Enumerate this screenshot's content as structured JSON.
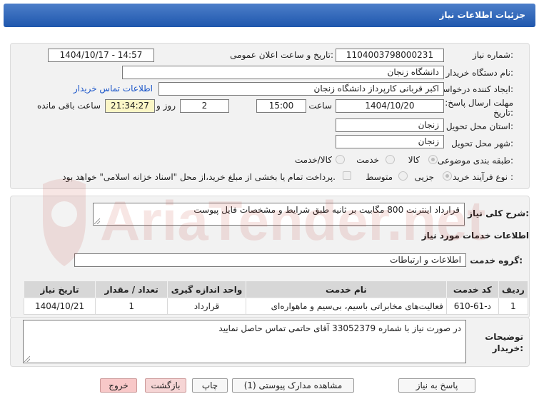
{
  "header": {
    "title": "جزئیات اطلاعات نیاز"
  },
  "details": {
    "need_number_label": "شماره نیاز:",
    "need_number": "1104003798000231",
    "announce_label": "تاریخ و ساعت اعلان عمومی:",
    "announce_value": "1404/10/17 - 14:57",
    "buyer_org_label": "نام دستگاه خریدار:",
    "buyer_org": "دانشگاه زنجان",
    "creator_label": "ایجاد کننده درخواست:",
    "creator": "اکبر قربانی کارپرداز دانشگاه زنجان",
    "contact_link": "اطلاعات تماس خریدار",
    "deadline_label_1": "مهلت ارسال پاسخ: تا",
    "deadline_label_2": "تاریخ:",
    "deadline_date": "1404/10/20",
    "time_label": "ساعت",
    "deadline_time": "15:00",
    "days_value": "2",
    "days_label": "روز و",
    "remaining_time": "21:34:27",
    "remaining_label": "ساعت باقی مانده",
    "province_label": "استان محل تحویل:",
    "province": "زنجان",
    "city_label": "شهر محل تحویل:",
    "city": "زنجان",
    "category_label": "طبقه بندی موضوعی:",
    "category_options": [
      "کالا",
      "خدمت",
      "کالا/خدمت"
    ],
    "process_label": "نوع فرآیند خرید :",
    "process_options": [
      "جزیی",
      "متوسط"
    ],
    "payment_note": "پرداخت تمام یا بخشی از مبلغ خرید،از محل \"اسناد خزانه اسلامی\" خواهد بود."
  },
  "summary": {
    "label": "شرح کلی نیاز:",
    "text": "قرارداد اینترنت 800 مگابیت بر ثانیه طبق شرایط و مشخصات فایل پیوست"
  },
  "services": {
    "section_title": "اطلاعات خدمات مورد نیاز",
    "group_label": "گروه خدمت:",
    "group_value": "اطلاعات و ارتباطات",
    "table": {
      "headers": [
        "ردیف",
        "کد خدمت",
        "نام خدمت",
        "واحد اندازه گیری",
        "تعداد / مقدار",
        "تاریخ نیاز"
      ],
      "rows": [
        [
          "1",
          "د-61-610",
          "فعالیت‌های مخابراتی باسیم، بی‌سیم و ماهواره‌ای",
          "قرارداد",
          "1",
          "1404/10/21"
        ]
      ]
    }
  },
  "buyer_notes": {
    "label_1": "توضیحات",
    "label_2": "خریدار:",
    "text": "در صورت نیاز با شماره 33052379 آقای حاتمی تماس حاصل نمایید"
  },
  "buttons": {
    "reply": "پاسخ به نیاز",
    "attachments": "مشاهده مدارک پیوستی (1)",
    "print": "چاپ",
    "back": "بازگشت",
    "exit": "خروج"
  },
  "watermark": {
    "text": "AriaTender.net"
  },
  "colors": {
    "header_top": "#4c7ec9",
    "header_bottom": "#1f57ad",
    "link": "#1a55c9",
    "remaining_bg": "#fbf6c6",
    "exit_bg": "#f8c8c8"
  }
}
